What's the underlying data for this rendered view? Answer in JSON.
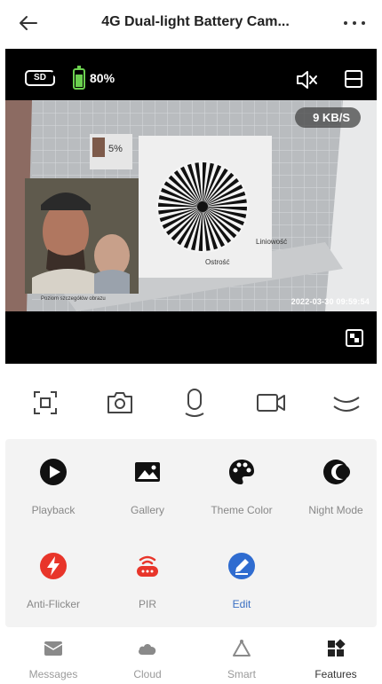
{
  "header": {
    "title": "4G Dual-light Battery Cam...",
    "back_icon": "back-arrow-icon",
    "more_icon": "more-dots-icon"
  },
  "video": {
    "sd_label": "SD",
    "battery_percent": 80,
    "battery_text": "80%",
    "speed": "9 KB/S",
    "timestamp": "2022-03-30 09:59:54",
    "battery_color": "#6bd04f"
  },
  "controls": [
    {
      "name": "screenshot-frame-icon"
    },
    {
      "name": "camera-icon"
    },
    {
      "name": "microphone-icon"
    },
    {
      "name": "video-record-icon"
    },
    {
      "name": "collapse-icon"
    }
  ],
  "features": [
    {
      "label": "Playback",
      "icon": "playback-icon"
    },
    {
      "label": "Gallery",
      "icon": "gallery-icon"
    },
    {
      "label": "Theme Color",
      "icon": "palette-icon"
    },
    {
      "label": "Night Mode",
      "icon": "night-mode-icon"
    },
    {
      "label": "Anti-Flicker",
      "icon": "lightning-icon",
      "color": "#e8352a"
    },
    {
      "label": "PIR",
      "icon": "pir-sensor-icon",
      "color": "#e8352a"
    },
    {
      "label": "Edit",
      "icon": "edit-pencil-icon",
      "color": "#2f6cd0"
    }
  ],
  "nav": [
    {
      "label": "Messages",
      "icon": "messages-icon"
    },
    {
      "label": "Cloud",
      "icon": "cloud-icon"
    },
    {
      "label": "Smart",
      "icon": "smart-icon"
    },
    {
      "label": "Features",
      "icon": "features-grid-icon",
      "active": true
    }
  ]
}
